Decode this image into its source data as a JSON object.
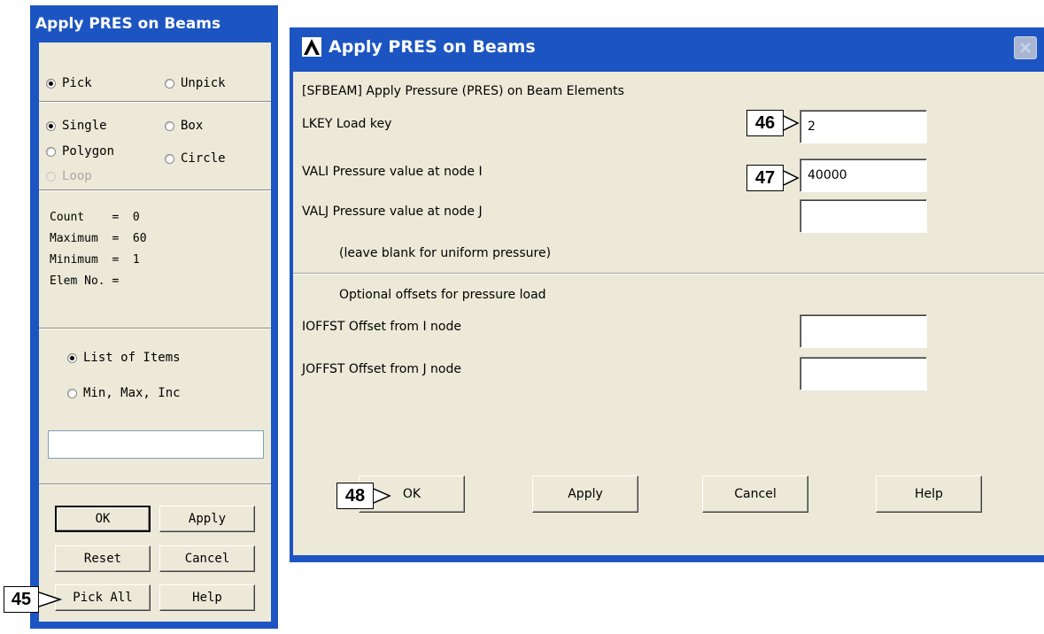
{
  "picker": {
    "title": "Apply PRES on Beams",
    "mode_pick": "Pick",
    "mode_unpick": "Unpick",
    "shape_single": "Single",
    "shape_box": "Box",
    "shape_polygon": "Polygon",
    "shape_circle": "Circle",
    "shape_loop": "Loop",
    "stats": {
      "count": "Count    =  0",
      "maximum": "Maximum  =  60",
      "minimum": "Minimum  =  1",
      "elem_no": "Elem No. ="
    },
    "list_of_items": "List of Items",
    "min_max_inc": "Min, Max, Inc",
    "input_value": "",
    "buttons": {
      "ok": "OK",
      "apply": "Apply",
      "reset": "Reset",
      "cancel": "Cancel",
      "pick_all": "Pick All",
      "help": "Help"
    }
  },
  "dialog": {
    "title": "Apply PRES on Beams",
    "command_label": "[SFBEAM]  Apply Pressure (PRES) on Beam Elements",
    "lkey_label": "LKEY   Load key",
    "lkey_value": "2",
    "vali_label": "VALI    Pressure value at node I",
    "vali_value": "40000",
    "valj_label": "VALJ    Pressure value at node J",
    "valj_value": "",
    "blank_note": "(leave blank for uniform pressure)",
    "offsets_header": "Optional offsets for pressure load",
    "ioffst_label": "IOFFST    Offset from I node",
    "ioffst_value": "",
    "joffst_label": "JOFFST    Offset from J node",
    "joffst_value": "",
    "buttons": {
      "ok": "OK",
      "apply": "Apply",
      "cancel": "Cancel",
      "help": "Help"
    }
  },
  "callouts": {
    "c45": "45",
    "c46": "46",
    "c47": "47",
    "c48": "48"
  },
  "colors": {
    "titlebar": "#1c54c2",
    "window_bg": "#ece9d8"
  }
}
